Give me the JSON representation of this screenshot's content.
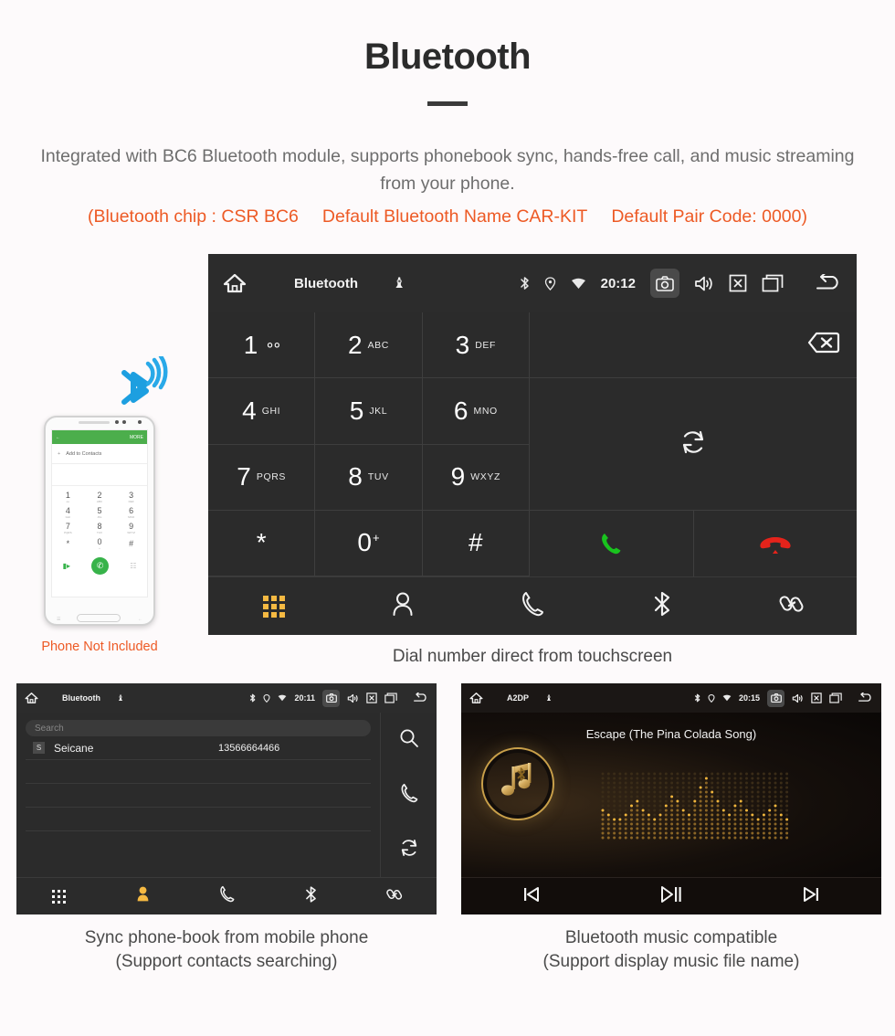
{
  "header": {
    "title": "Bluetooth",
    "description": "Integrated with BC6 Bluetooth module, supports phonebook sync, hands-free call, and music streaming from your phone.",
    "spec_open": "(Bluetooth chip : CSR BC6",
    "spec_name": "Default Bluetooth Name CAR-KIT",
    "spec_pair": "Default Pair Code: 0000)",
    "accent_color": "#ed5a25",
    "text_color": "#6e6e6e"
  },
  "dialer_screen": {
    "statusbar": {
      "title": "Bluetooth",
      "clock": "20:12",
      "icons": [
        "home-icon",
        "usb-icon",
        "bluetooth-icon",
        "location-icon",
        "wifi-icon",
        "camera-icon",
        "volume-icon",
        "close-icon",
        "recents-icon",
        "back-icon"
      ]
    },
    "keys": [
      {
        "num": "1",
        "sub": "",
        "voicemail": true
      },
      {
        "num": "2",
        "sub": "ABC"
      },
      {
        "num": "3",
        "sub": "DEF"
      },
      {
        "num": "4",
        "sub": "GHI"
      },
      {
        "num": "5",
        "sub": "JKL"
      },
      {
        "num": "6",
        "sub": "MNO"
      },
      {
        "num": "7",
        "sub": "PQRS"
      },
      {
        "num": "8",
        "sub": "TUV"
      },
      {
        "num": "9",
        "sub": "WXYZ"
      },
      {
        "num": "*",
        "sub": ""
      },
      {
        "num": "0",
        "sub": "",
        "plus": "+"
      },
      {
        "num": "#",
        "sub": ""
      }
    ],
    "number_input_value": "",
    "buttons": {
      "backspace": "backspace-icon",
      "sync": "sync-icon",
      "call": "call-icon",
      "hangup": "hangup-icon"
    },
    "nav": [
      {
        "name": "keypad",
        "icon": "keypad-icon",
        "active": true
      },
      {
        "name": "contacts",
        "icon": "contact-icon",
        "active": false
      },
      {
        "name": "call-log",
        "icon": "phone-icon",
        "active": false
      },
      {
        "name": "bluetooth",
        "icon": "bluetooth-icon",
        "active": false
      },
      {
        "name": "link",
        "icon": "link-icon",
        "active": false
      }
    ],
    "accent": "#f5b942",
    "call_color": "#19c31e",
    "hangup_color": "#e5231b"
  },
  "phone_mockup": {
    "header_more": "MORE",
    "add_contact": "Add to Contacts",
    "add_plus": "+",
    "keys": [
      {
        "n": "1",
        "s": "oo"
      },
      {
        "n": "2",
        "s": "ABC"
      },
      {
        "n": "3",
        "s": "DEF"
      },
      {
        "n": "4",
        "s": "GHI"
      },
      {
        "n": "5",
        "s": "JKL"
      },
      {
        "n": "6",
        "s": "MNO"
      },
      {
        "n": "7",
        "s": "PQRS"
      },
      {
        "n": "8",
        "s": "TUV"
      },
      {
        "n": "9",
        "s": "WXYZ"
      },
      {
        "n": "*",
        "s": ""
      },
      {
        "n": "0",
        "s": "+"
      },
      {
        "n": "#",
        "s": ""
      }
    ],
    "not_included": "Phone Not Included"
  },
  "captions": {
    "dialer": "Dial number direct from touchscreen",
    "phonebook_line1": "Sync phone-book from mobile phone",
    "phonebook_line2": "(Support contacts searching)",
    "music_line1": "Bluetooth music compatible",
    "music_line2": "(Support display music file name)"
  },
  "phonebook_screen": {
    "statusbar": {
      "title": "Bluetooth",
      "clock": "20:11"
    },
    "search_placeholder": "Search",
    "search_value": "",
    "contacts": [
      {
        "initial": "S",
        "name": "Seicane",
        "number": "13566664466"
      }
    ],
    "side_buttons": [
      {
        "name": "search",
        "icon": "search-icon"
      },
      {
        "name": "call",
        "icon": "phone-icon"
      },
      {
        "name": "sync",
        "icon": "sync-icon"
      }
    ],
    "nav": [
      {
        "name": "keypad",
        "icon": "keypad-icon",
        "active": false
      },
      {
        "name": "contacts",
        "icon": "contact-icon",
        "active": true
      },
      {
        "name": "call-log",
        "icon": "phone-icon",
        "active": false
      },
      {
        "name": "bluetooth",
        "icon": "bluetooth-icon",
        "active": false
      },
      {
        "name": "link",
        "icon": "link-icon",
        "active": false
      }
    ]
  },
  "music_screen": {
    "statusbar": {
      "title": "A2DP",
      "clock": "20:15"
    },
    "track_title": "Escape (The Pina Colada Song)",
    "album_icon": "music-note-bluetooth-icon",
    "controls": [
      {
        "name": "previous",
        "icon": "skip-previous-icon"
      },
      {
        "name": "play-pause",
        "icon": "play-pause-icon"
      },
      {
        "name": "next",
        "icon": "skip-next-icon"
      }
    ],
    "accent": "#c9a04a"
  }
}
